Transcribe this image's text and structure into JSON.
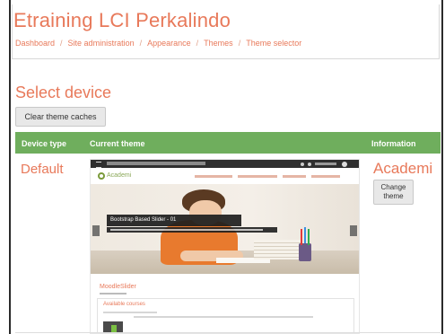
{
  "site": {
    "title": "Etraining LCI Perkalindo"
  },
  "breadcrumb": [
    "Dashboard",
    "Site administration",
    "Appearance",
    "Themes",
    "Theme selector"
  ],
  "page": {
    "heading": "Select device",
    "clear_button": "Clear theme caches"
  },
  "table": {
    "headers": [
      "Device type",
      "Current theme",
      "Information"
    ],
    "rows": [
      {
        "device": "Default",
        "theme_name": "Academi",
        "change_button": "Change theme"
      }
    ]
  },
  "preview": {
    "logo_text": "Academi",
    "slider_caption": "Bootstrap Based Slider - 01",
    "site_name": "MoodleSlider",
    "available_courses": "Available courses"
  },
  "colors": {
    "accent": "#e8795a",
    "header_bar": "#6fae5d"
  }
}
